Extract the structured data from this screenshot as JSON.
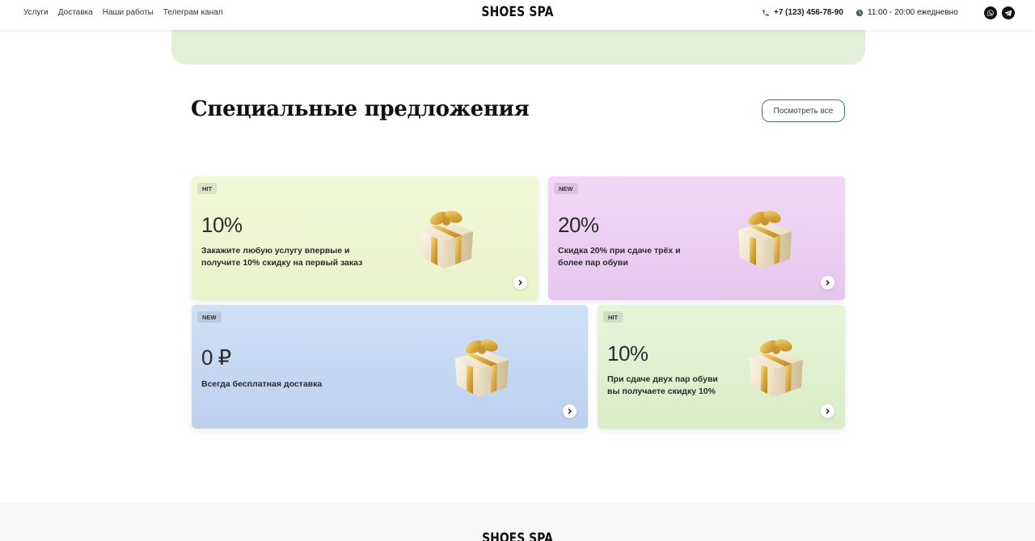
{
  "header": {
    "nav": [
      "Услуги",
      "Доставка",
      "Наши работы",
      "Телеграм канал"
    ],
    "logo": "SHOES SPA",
    "phone": "+7 (123) 456-78-90",
    "hours": "11:00 - 20:00 ежедневно",
    "social": [
      "whatsapp-icon",
      "telegram-icon"
    ]
  },
  "section": {
    "title": "Специальные предложения",
    "view_all": "Посмотреть все"
  },
  "cards": [
    {
      "badge": "HIT",
      "value": "10%",
      "desc": "Закажите любую услугу впервые и получите 10% скидку на первый заказ",
      "color": "#eef7d3"
    },
    {
      "badge": "NEW",
      "value": "20%",
      "desc": "Скидка 20% при сдаче трёх и более пар обуви",
      "color": "#ecd0f3"
    },
    {
      "badge": "NEW",
      "value": "0 ₽",
      "desc": "Всегда бесплатная доставка",
      "color": "#c6d9f3"
    },
    {
      "badge": "HIT",
      "value": "10%",
      "desc": "При сдаче двух пар обуви вы получаете скидку 10%",
      "color": "#e0f0d0"
    }
  ],
  "footer": {
    "logo": "SHOES SPA"
  },
  "colors": {
    "accent": "#4a7a55",
    "banner": "#e3efd7"
  }
}
